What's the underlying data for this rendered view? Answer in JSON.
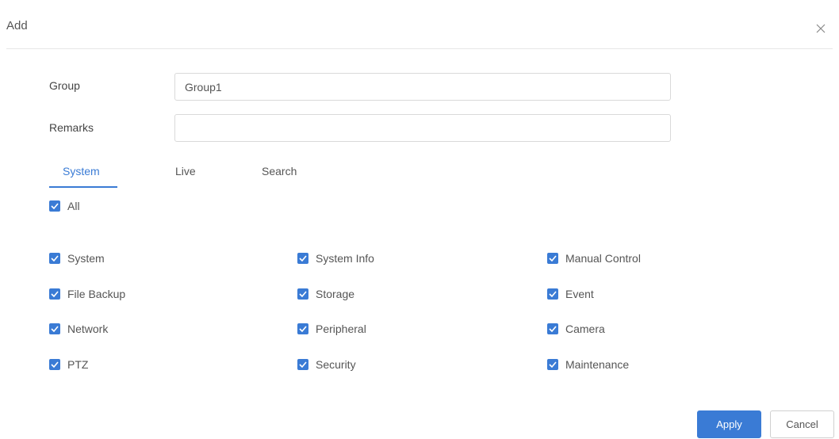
{
  "dialog": {
    "title": "Add",
    "close_icon": "close-icon"
  },
  "form": {
    "group_label": "Group",
    "group_value": "Group1",
    "remarks_label": "Remarks",
    "remarks_value": ""
  },
  "tabs": [
    {
      "label": "System",
      "active": true
    },
    {
      "label": "Live",
      "active": false
    },
    {
      "label": "Search",
      "active": false
    }
  ],
  "all_option": {
    "label": "All",
    "checked": true
  },
  "permissions": [
    {
      "label": "System",
      "checked": true
    },
    {
      "label": "System Info",
      "checked": true
    },
    {
      "label": "Manual Control",
      "checked": true
    },
    {
      "label": "File Backup",
      "checked": true
    },
    {
      "label": "Storage",
      "checked": true
    },
    {
      "label": "Event",
      "checked": true
    },
    {
      "label": "Network",
      "checked": true
    },
    {
      "label": "Peripheral",
      "checked": true
    },
    {
      "label": "Camera",
      "checked": true
    },
    {
      "label": "PTZ",
      "checked": true
    },
    {
      "label": "Security",
      "checked": true
    },
    {
      "label": "Maintenance",
      "checked": true
    }
  ],
  "buttons": {
    "apply": "Apply",
    "cancel": "Cancel"
  },
  "colors": {
    "accent": "#3a7bd5",
    "divider": "#e6e6e6"
  }
}
